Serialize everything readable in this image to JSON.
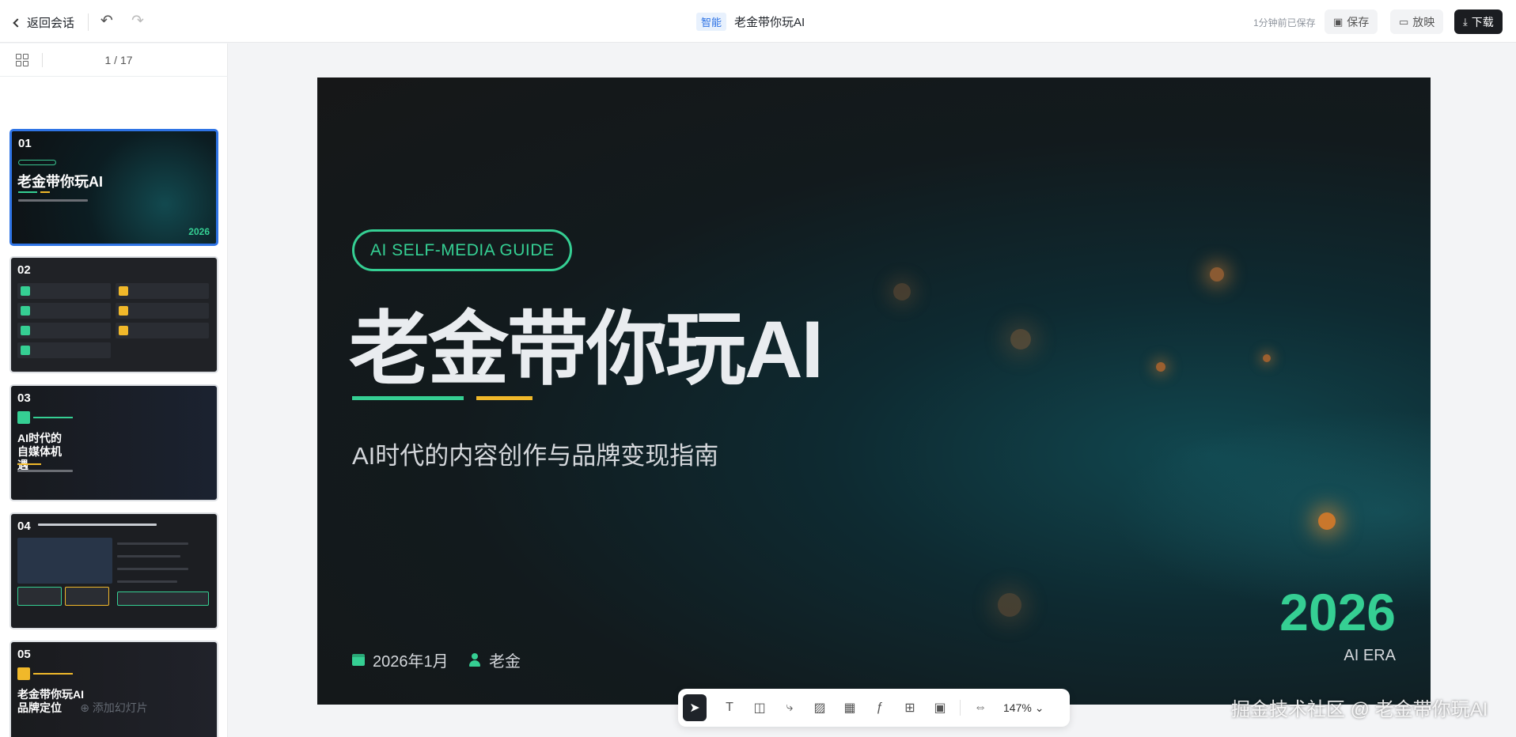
{
  "topbar": {
    "back_label": "返回会话",
    "smart_tag": "智能",
    "doc_title": "老金带你玩AI",
    "saved_status": "1分钟前已保存",
    "save_label": "保存",
    "play_label": "放映",
    "download_label": "下载"
  },
  "sidebar": {
    "page_counter": "1 / 17",
    "add_slide_label": "添加幻灯片",
    "thumbnails": [
      {
        "number": "01",
        "title": "老金带你玩AI",
        "year": "2026"
      },
      {
        "number": "02"
      },
      {
        "number": "03",
        "title": "AI时代的自媒体机遇"
      },
      {
        "number": "04"
      },
      {
        "number": "05",
        "title": "老金带你玩AI品牌定位"
      }
    ]
  },
  "slide": {
    "badge": "AI SELF-MEDIA GUIDE",
    "title": "老金带你玩AI",
    "subtitle": "AI时代的内容创作与品牌变现指南",
    "date": "2026年1月",
    "author": "老金",
    "year": "2026",
    "era": "AI ERA",
    "accent_green": "#35cf93",
    "accent_yellow": "#f0b82a"
  },
  "toolbar": {
    "zoom": "147%",
    "tools": [
      "select-icon",
      "text-icon",
      "shape-icon",
      "connector-icon",
      "image-icon",
      "table-icon",
      "formula-icon",
      "component-icon",
      "media-icon",
      "fit-width-icon"
    ]
  },
  "watermark": "掘金技术社区 @ 老金带你玩AI"
}
